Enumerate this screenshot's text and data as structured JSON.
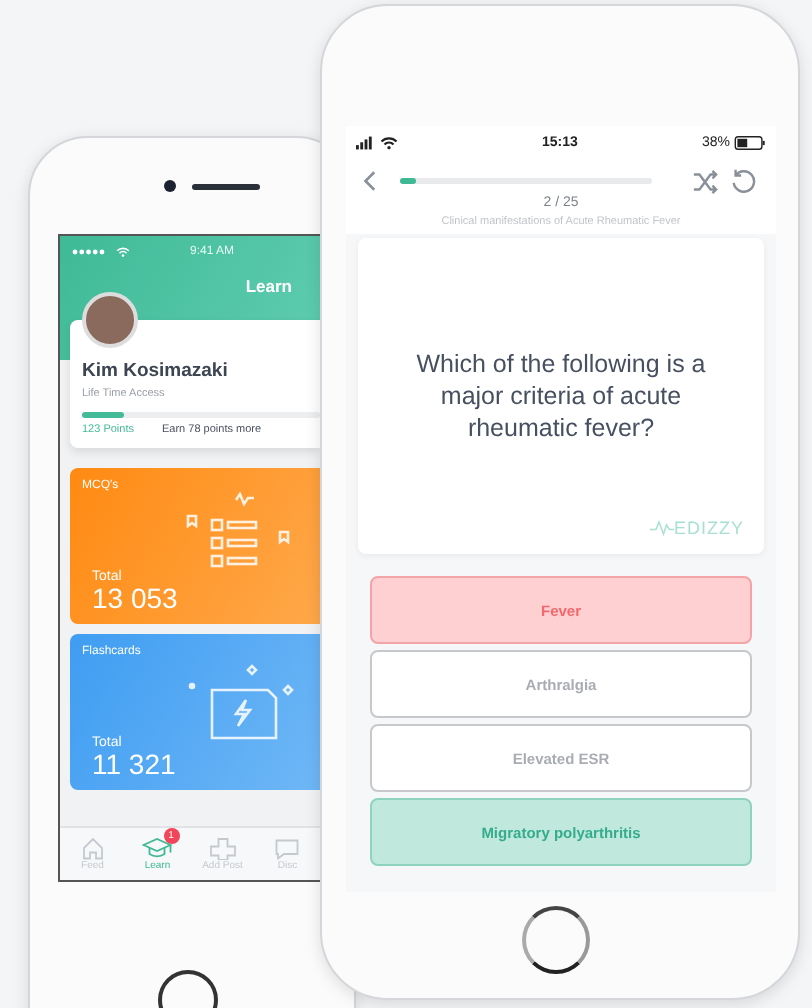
{
  "left_phone": {
    "status_bar": {
      "time": "9:41 AM"
    },
    "header": {
      "title": "Learn"
    },
    "profile": {
      "name": "Kim Kosimazaki",
      "plan": "Life Time Access",
      "points": "123 Points",
      "goal": "Earn 78 points more",
      "level": 0.18
    },
    "cards": [
      {
        "kind": "mcq",
        "title": "MCQ's",
        "total_label": "Total",
        "total": "13 053"
      },
      {
        "kind": "flashcards",
        "title": "Flashcards",
        "total_label": "Total",
        "total": "11 321"
      }
    ],
    "tabs": [
      {
        "kind": "home",
        "label": "Feed",
        "selected": false
      },
      {
        "kind": "learn",
        "label": "Learn",
        "selected": true,
        "badge": "1"
      },
      {
        "kind": "add",
        "label": "Add Post",
        "selected": false
      },
      {
        "kind": "chat",
        "label": "Disc",
        "selected": false
      }
    ]
  },
  "right_phone": {
    "status_bar": {
      "time": "15:13",
      "battery": "38%"
    },
    "quiz": {
      "level": 0.06,
      "counter": "2 / 25",
      "topic": "Clinical manifestations of Acute Rheumatic Fever",
      "question": "Which of the following is a major criteria of acute rheumatic fever?",
      "logo": "EDIZZY"
    },
    "answers": [
      {
        "label": "Fever",
        "kind": "wrong"
      },
      {
        "label": "Arthralgia",
        "kind": "neutral"
      },
      {
        "label": "Elevated ESR",
        "kind": "neutral"
      },
      {
        "label": "Migratory polyarthritis",
        "kind": "correct"
      }
    ]
  }
}
